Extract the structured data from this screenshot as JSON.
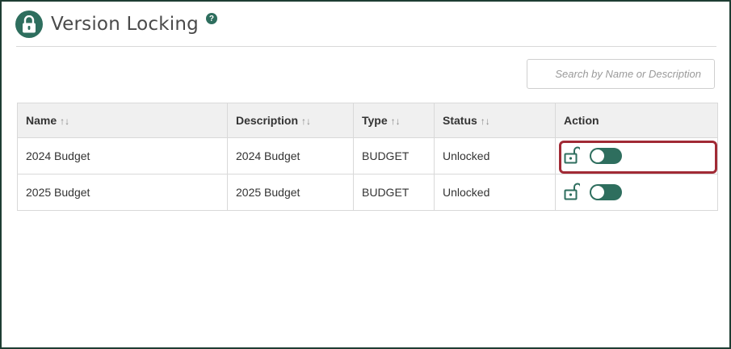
{
  "page": {
    "title": "Version Locking",
    "help_icon": "question-circle",
    "title_icon": "padlock"
  },
  "search": {
    "placeholder": "Search by Name or Description",
    "value": ""
  },
  "table": {
    "columns": [
      {
        "label": "Name",
        "sort_icon": "↑↓"
      },
      {
        "label": "Description",
        "sort_icon": "↑↓"
      },
      {
        "label": "Type",
        "sort_icon": "↑↓"
      },
      {
        "label": "Status",
        "sort_icon": "↑↓"
      },
      {
        "label": "Action"
      }
    ],
    "rows": [
      {
        "name": "2024 Budget",
        "description": "2024 Budget",
        "type": "BUDGET",
        "status": "Unlocked",
        "lock_icon": "unlock-icon",
        "toggle_on": true
      },
      {
        "name": "2025 Budget",
        "description": "2025 Budget",
        "type": "BUDGET",
        "status": "Unlocked",
        "lock_icon": "unlock-icon",
        "toggle_on": true
      }
    ]
  },
  "colors": {
    "accent": "#2e6e5e",
    "highlight": "#a12a35",
    "frame_border": "#1e3d33"
  }
}
